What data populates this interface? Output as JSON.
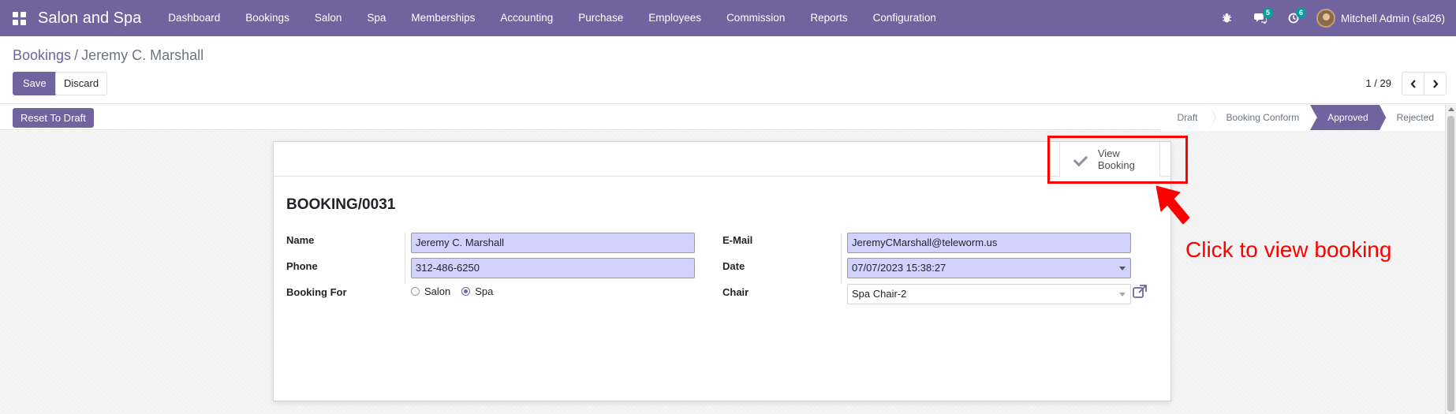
{
  "navbar": {
    "app_name": "Salon and Spa",
    "menu": [
      "Dashboard",
      "Bookings",
      "Salon",
      "Spa",
      "Memberships",
      "Accounting",
      "Purchase",
      "Employees",
      "Commission",
      "Reports",
      "Configuration"
    ],
    "messages_count": "5",
    "activities_count": "6",
    "user": "Mitchell Admin (sal26)"
  },
  "breadcrumb": {
    "parent": "Bookings",
    "current": "Jeremy C. Marshall"
  },
  "actions": {
    "save": "Save",
    "discard": "Discard",
    "reset": "Reset To Draft"
  },
  "pager": {
    "text": "1 / 29"
  },
  "stages": {
    "draft": "Draft",
    "booking_conform": "Booking Conform",
    "approved": "Approved",
    "rejected": "Rejected",
    "current": "Approved"
  },
  "smart_button": {
    "label": "View Booking"
  },
  "form": {
    "reference": "BOOKING/0031",
    "name_label": "Name",
    "name_value": "Jeremy C. Marshall",
    "phone_label": "Phone",
    "phone_value": "312-486-6250",
    "booking_for_label": "Booking For",
    "booking_for_options": [
      "Salon",
      "Spa"
    ],
    "booking_for_selected": "Spa",
    "email_label": "E-Mail",
    "email_value": "JeremyCMarshall@teleworm.us",
    "date_label": "Date",
    "date_value": "07/07/2023 15:38:27",
    "chair_label": "Chair",
    "chair_value": "Spa Chair-2"
  },
  "annotation": {
    "text": "Click to view booking",
    "color": "#ff0000"
  },
  "colors": {
    "brand": "#71639e",
    "input_required": "#d2d2ff",
    "badge": "#00a09d"
  }
}
